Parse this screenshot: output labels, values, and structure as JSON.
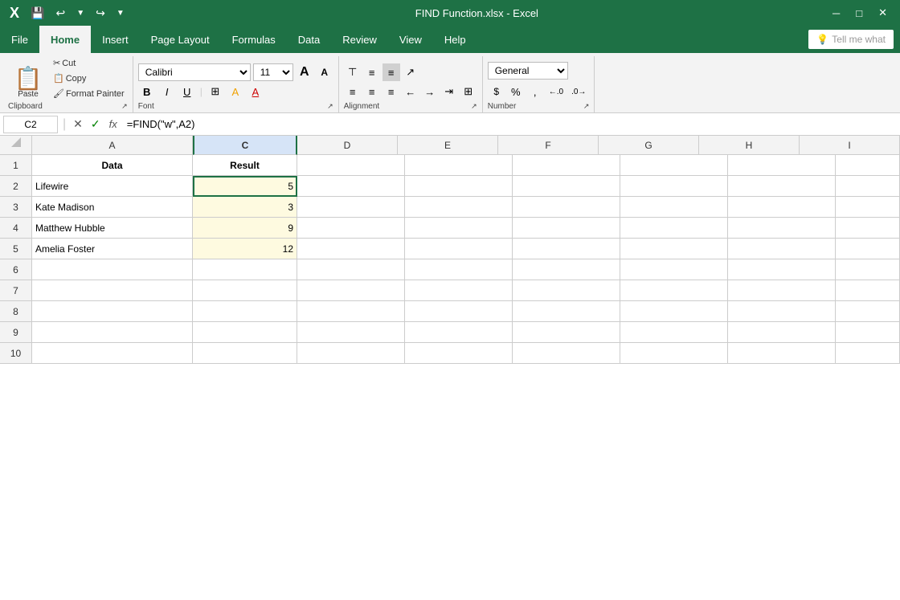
{
  "titleBar": {
    "title": "FIND Function.xlsx  -  Excel",
    "quickAccess": [
      "💾",
      "↩",
      "↪",
      "▼"
    ]
  },
  "tabs": [
    {
      "label": "File",
      "active": false
    },
    {
      "label": "Home",
      "active": true
    },
    {
      "label": "Insert",
      "active": false
    },
    {
      "label": "Page Layout",
      "active": false
    },
    {
      "label": "Formulas",
      "active": false
    },
    {
      "label": "Data",
      "active": false
    },
    {
      "label": "Review",
      "active": false
    },
    {
      "label": "View",
      "active": false
    },
    {
      "label": "Help",
      "active": false
    }
  ],
  "ribbon": {
    "clipboard": {
      "paste": "Paste",
      "cut": "✂",
      "copy": "📋",
      "painter": "🖌",
      "label": "Clipboard"
    },
    "font": {
      "family": "Calibri",
      "size": "11",
      "growIcon": "A",
      "shrinkIcon": "A",
      "bold": "B",
      "italic": "I",
      "underline": "U",
      "label": "Font"
    },
    "alignment": {
      "label": "Alignment"
    },
    "number": {
      "format": "General",
      "label": "Number"
    },
    "tellMe": "Tell me what"
  },
  "formulaBar": {
    "cellRef": "C2",
    "formula": "=FIND(\"w\",A2)",
    "cancelBtn": "✕",
    "confirmBtn": "✓",
    "fxLabel": "fx"
  },
  "columns": [
    "A",
    "C",
    "D",
    "E",
    "F",
    "G",
    "H",
    "I"
  ],
  "columnHeaders": [
    {
      "label": "A",
      "class": "ch-a"
    },
    {
      "label": "C",
      "class": "ch-c",
      "selected": true
    },
    {
      "label": "D",
      "class": "ch-d"
    },
    {
      "label": "E",
      "class": "ch-e"
    },
    {
      "label": "F",
      "class": "ch-f"
    },
    {
      "label": "G",
      "class": "ch-g"
    },
    {
      "label": "H",
      "class": "ch-h"
    },
    {
      "label": "I",
      "class": "ch-i"
    }
  ],
  "rows": [
    {
      "rowNum": "1",
      "cells": [
        {
          "col": "a",
          "value": "Data",
          "type": "header"
        },
        {
          "col": "c",
          "value": "Result",
          "type": "header"
        },
        {
          "col": "d",
          "value": ""
        },
        {
          "col": "e",
          "value": ""
        },
        {
          "col": "f",
          "value": ""
        },
        {
          "col": "g",
          "value": ""
        },
        {
          "col": "h",
          "value": ""
        },
        {
          "col": "i",
          "value": ""
        }
      ]
    },
    {
      "rowNum": "2",
      "cells": [
        {
          "col": "a",
          "value": "Lifewire",
          "type": "data"
        },
        {
          "col": "c",
          "value": "5",
          "type": "active-result"
        },
        {
          "col": "d",
          "value": ""
        },
        {
          "col": "e",
          "value": ""
        },
        {
          "col": "f",
          "value": ""
        },
        {
          "col": "g",
          "value": ""
        },
        {
          "col": "h",
          "value": ""
        },
        {
          "col": "i",
          "value": ""
        }
      ]
    },
    {
      "rowNum": "3",
      "cells": [
        {
          "col": "a",
          "value": "Kate Madison",
          "type": "data"
        },
        {
          "col": "c",
          "value": "3",
          "type": "result"
        },
        {
          "col": "d",
          "value": ""
        },
        {
          "col": "e",
          "value": ""
        },
        {
          "col": "f",
          "value": ""
        },
        {
          "col": "g",
          "value": ""
        },
        {
          "col": "h",
          "value": ""
        },
        {
          "col": "i",
          "value": ""
        }
      ]
    },
    {
      "rowNum": "4",
      "cells": [
        {
          "col": "a",
          "value": "Matthew Hubble",
          "type": "data"
        },
        {
          "col": "c",
          "value": "9",
          "type": "result"
        },
        {
          "col": "d",
          "value": ""
        },
        {
          "col": "e",
          "value": ""
        },
        {
          "col": "f",
          "value": ""
        },
        {
          "col": "g",
          "value": ""
        },
        {
          "col": "h",
          "value": ""
        },
        {
          "col": "i",
          "value": ""
        }
      ]
    },
    {
      "rowNum": "5",
      "cells": [
        {
          "col": "a",
          "value": "Amelia Foster",
          "type": "data"
        },
        {
          "col": "c",
          "value": "12",
          "type": "result"
        },
        {
          "col": "d",
          "value": ""
        },
        {
          "col": "e",
          "value": ""
        },
        {
          "col": "f",
          "value": ""
        },
        {
          "col": "g",
          "value": ""
        },
        {
          "col": "h",
          "value": ""
        },
        {
          "col": "i",
          "value": ""
        }
      ]
    },
    {
      "rowNum": "6",
      "cells": [
        {
          "col": "a",
          "value": ""
        },
        {
          "col": "c",
          "value": ""
        },
        {
          "col": "d",
          "value": ""
        },
        {
          "col": "e",
          "value": ""
        },
        {
          "col": "f",
          "value": ""
        },
        {
          "col": "g",
          "value": ""
        },
        {
          "col": "h",
          "value": ""
        },
        {
          "col": "i",
          "value": ""
        }
      ]
    },
    {
      "rowNum": "7",
      "cells": [
        {
          "col": "a",
          "value": ""
        },
        {
          "col": "c",
          "value": ""
        },
        {
          "col": "d",
          "value": ""
        },
        {
          "col": "e",
          "value": ""
        },
        {
          "col": "f",
          "value": ""
        },
        {
          "col": "g",
          "value": ""
        },
        {
          "col": "h",
          "value": ""
        },
        {
          "col": "i",
          "value": ""
        }
      ]
    },
    {
      "rowNum": "8",
      "cells": [
        {
          "col": "a",
          "value": ""
        },
        {
          "col": "c",
          "value": ""
        },
        {
          "col": "d",
          "value": ""
        },
        {
          "col": "e",
          "value": ""
        },
        {
          "col": "f",
          "value": ""
        },
        {
          "col": "g",
          "value": ""
        },
        {
          "col": "h",
          "value": ""
        },
        {
          "col": "i",
          "value": ""
        }
      ]
    },
    {
      "rowNum": "9",
      "cells": [
        {
          "col": "a",
          "value": ""
        },
        {
          "col": "c",
          "value": ""
        },
        {
          "col": "d",
          "value": ""
        },
        {
          "col": "e",
          "value": ""
        },
        {
          "col": "f",
          "value": ""
        },
        {
          "col": "g",
          "value": ""
        },
        {
          "col": "h",
          "value": ""
        },
        {
          "col": "i",
          "value": ""
        }
      ]
    },
    {
      "rowNum": "10",
      "cells": [
        {
          "col": "a",
          "value": ""
        },
        {
          "col": "c",
          "value": ""
        },
        {
          "col": "d",
          "value": ""
        },
        {
          "col": "e",
          "value": ""
        },
        {
          "col": "f",
          "value": ""
        },
        {
          "col": "g",
          "value": ""
        },
        {
          "col": "h",
          "value": ""
        },
        {
          "col": "i",
          "value": ""
        }
      ]
    }
  ]
}
